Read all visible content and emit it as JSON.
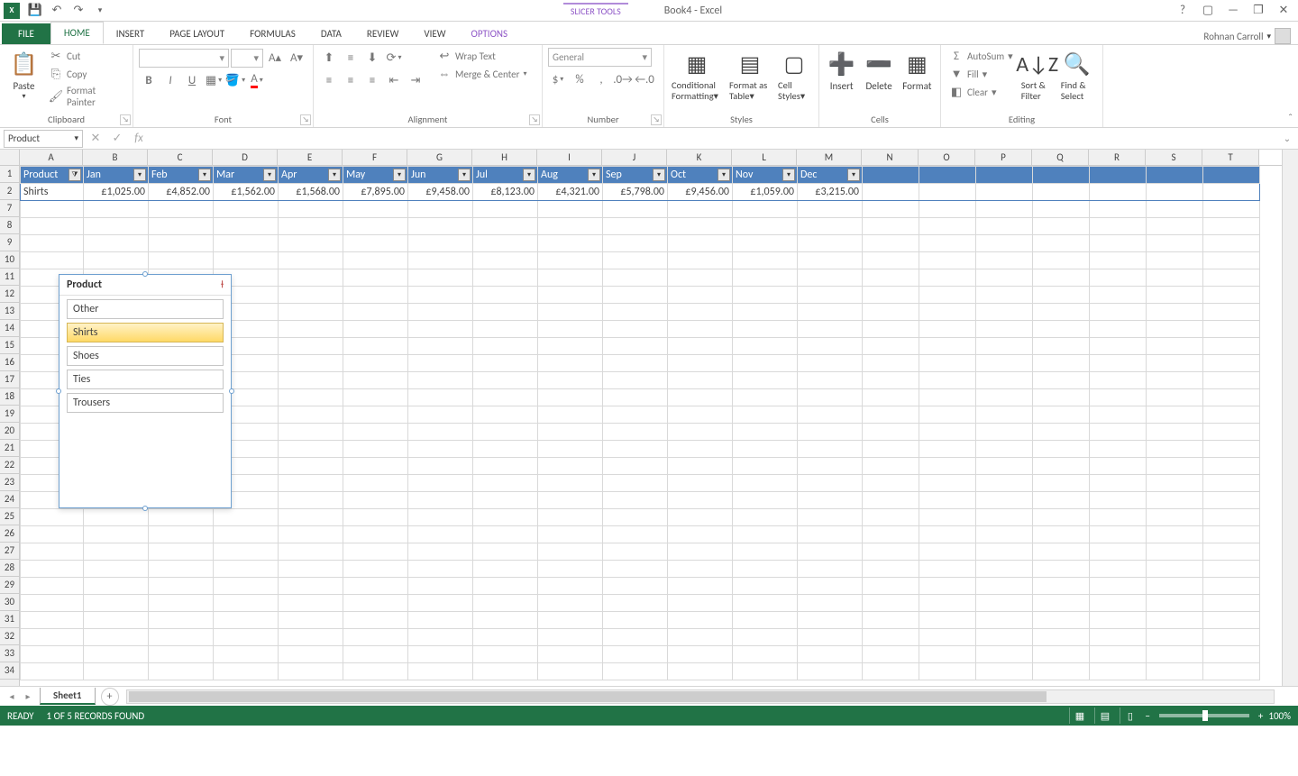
{
  "titlebar": {
    "slicer_tools": "SLICER TOOLS",
    "doc_title": "Book4 - Excel"
  },
  "tabs": {
    "file": "FILE",
    "home": "HOME",
    "insert": "INSERT",
    "pagelayout": "PAGE LAYOUT",
    "formulas": "FORMULAS",
    "data": "DATA",
    "review": "REVIEW",
    "view": "VIEW",
    "options": "OPTIONS"
  },
  "user": {
    "name": "Rohnan Carroll"
  },
  "ribbon": {
    "clipboard": {
      "paste": "Paste",
      "cut": "Cut",
      "copy": "Copy",
      "painter": "Format Painter",
      "label": "Clipboard"
    },
    "font": {
      "label": "Font",
      "font_name": "",
      "font_size": ""
    },
    "alignment": {
      "wrap": "Wrap Text",
      "merge": "Merge & Center",
      "label": "Alignment"
    },
    "number": {
      "format": "General",
      "label": "Number"
    },
    "styles": {
      "cond": "Conditional Formatting",
      "fat": "Format as Table",
      "cell": "Cell Styles",
      "label": "Styles"
    },
    "cells": {
      "insert": "Insert",
      "delete": "Delete",
      "format": "Format",
      "label": "Cells"
    },
    "editing": {
      "autosum": "AutoSum",
      "fill": "Fill",
      "clear": "Clear",
      "sort": "Sort & Filter",
      "find": "Find & Select",
      "label": "Editing"
    }
  },
  "formula_bar": {
    "name_box": "Product",
    "formula": ""
  },
  "columns": [
    "A",
    "B",
    "C",
    "D",
    "E",
    "F",
    "G",
    "H",
    "I",
    "J",
    "K",
    "L",
    "M",
    "N",
    "O",
    "P",
    "Q",
    "R",
    "S",
    "T"
  ],
  "visible_rows": [
    1,
    2,
    7,
    8,
    9,
    10,
    11,
    12,
    13,
    14,
    15,
    16,
    17,
    18,
    19,
    20,
    21,
    22,
    23,
    24,
    25,
    26,
    27,
    28,
    29,
    30,
    31,
    32,
    33,
    34
  ],
  "table": {
    "headers": [
      "Product",
      "Jan",
      "Feb",
      "Mar",
      "Apr",
      "May",
      "Jun",
      "Jul",
      "Aug",
      "Sep",
      "Oct",
      "Nov",
      "Dec"
    ],
    "rows": [
      {
        "product": "Shirts",
        "values": [
          "£1,025.00",
          "£4,852.00",
          "£1,562.00",
          "£1,568.00",
          "£7,895.00",
          "£9,458.00",
          "£8,123.00",
          "£4,321.00",
          "£5,798.00",
          "£9,456.00",
          "£1,059.00",
          "£3,215.00"
        ]
      }
    ]
  },
  "slicer": {
    "title": "Product",
    "items": [
      {
        "label": "Other",
        "selected": false
      },
      {
        "label": "Shirts",
        "selected": true
      },
      {
        "label": "Shoes",
        "selected": false
      },
      {
        "label": "Ties",
        "selected": false
      },
      {
        "label": "Trousers",
        "selected": false
      }
    ]
  },
  "sheet_tabs": {
    "sheet1": "Sheet1"
  },
  "status": {
    "ready": "READY",
    "records": "1 OF 5 RECORDS FOUND",
    "zoom": "100%",
    "minus": "−",
    "plus": "+"
  }
}
